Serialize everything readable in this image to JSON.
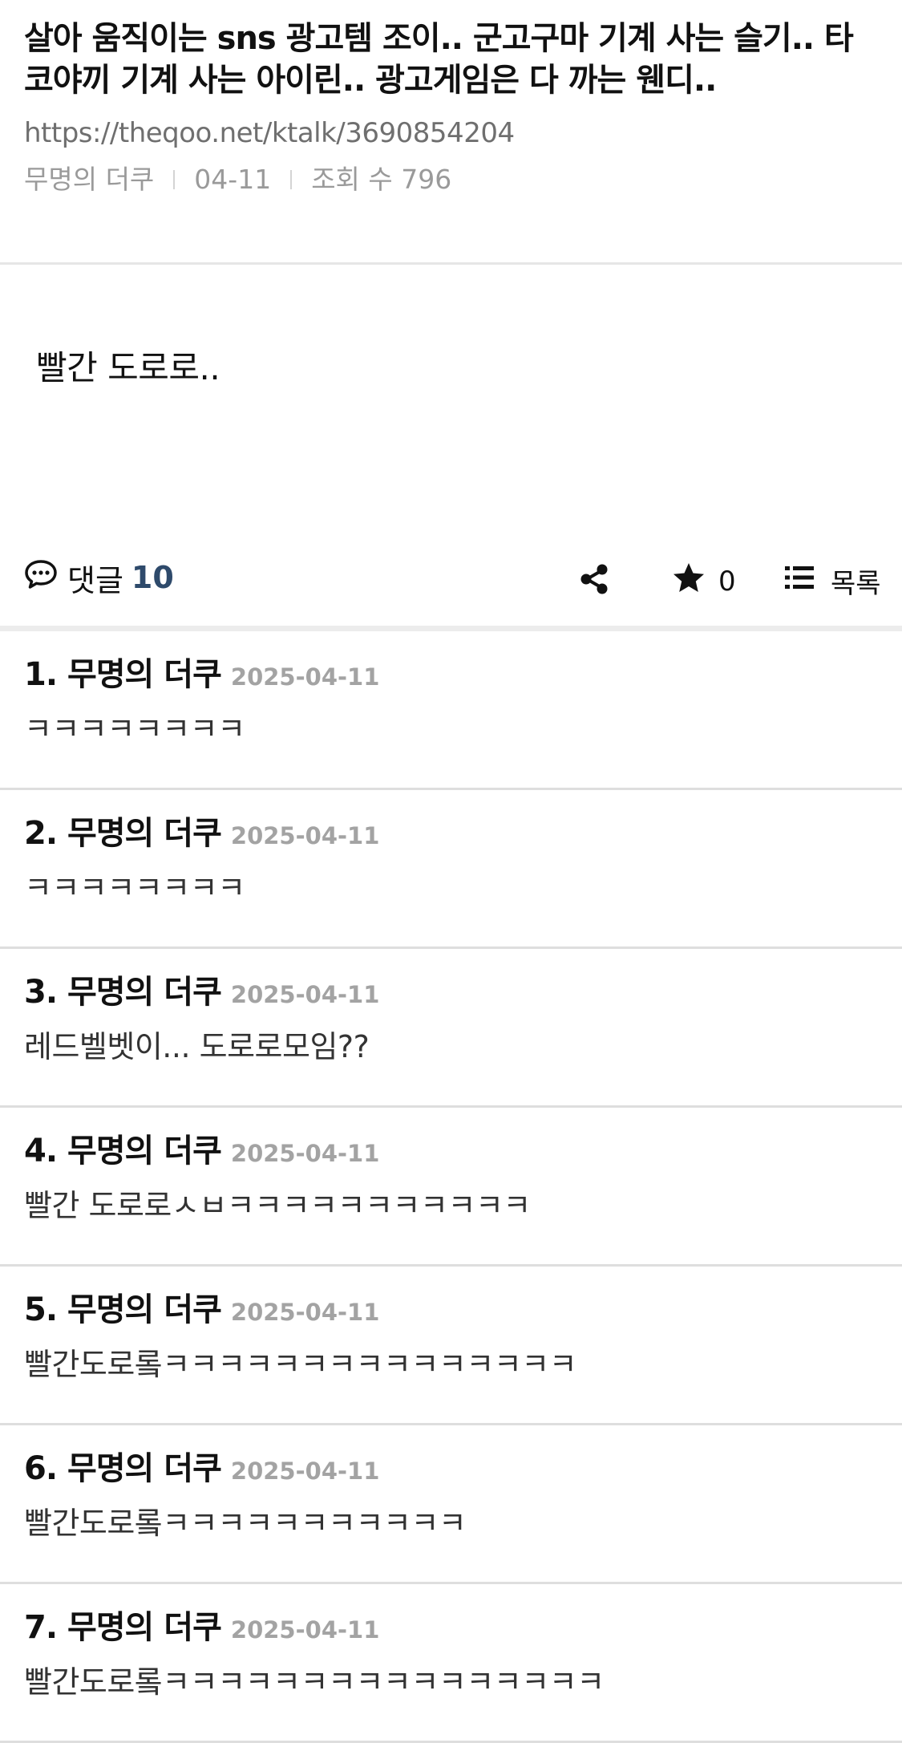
{
  "post": {
    "title": "살아 움직이는 sns 광고템 조이.. 군고구마 기계 사는 슬기.. 타코야끼 기계 사는 아이린.. 광고게임은 다 까는 웬디..",
    "url": "https://theqoo.net/ktalk/3690854204",
    "author": "무명의 더쿠",
    "date": "04-11",
    "views_label": "조회 수 796",
    "body": "빨간 도로로.."
  },
  "actions": {
    "comment_label": "댓글",
    "comment_count": "10",
    "share_icon": "share-icon",
    "star_icon": "star-icon",
    "star_count": "0",
    "list_icon": "list-icon",
    "list_label": "목록"
  },
  "comments": [
    {
      "author": "1. 무명의 더쿠",
      "date": "2025-04-11",
      "text": "ㅋㅋㅋㅋㅋㅋㅋㅋ"
    },
    {
      "author": "2. 무명의 더쿠",
      "date": "2025-04-11",
      "text": "ㅋㅋㅋㅋㅋㅋㅋㅋ"
    },
    {
      "author": "3. 무명의 더쿠",
      "date": "2025-04-11",
      "text": "레드벨벳이... 도로로모임??"
    },
    {
      "author": "4. 무명의 더쿠",
      "date": "2025-04-11",
      "text": "빨간 도로로ㅅㅂㅋㅋㅋㅋㅋㅋㅋㅋㅋㅋㅋ"
    },
    {
      "author": "5. 무명의 더쿠",
      "date": "2025-04-11",
      "text": "빨간도로롴ㅋㅋㅋㅋㅋㅋㅋㅋㅋㅋㅋㅋㅋㅋㅋ"
    },
    {
      "author": "6. 무명의 더쿠",
      "date": "2025-04-11",
      "text": "빨간도로롴ㅋㅋㅋㅋㅋㅋㅋㅋㅋㅋㅋ"
    },
    {
      "author": "7. 무명의 더쿠",
      "date": "2025-04-11",
      "text": "빨간도로롴ㅋㅋㅋㅋㅋㅋㅋㅋㅋㅋㅋㅋㅋㅋㅋㅋ"
    }
  ]
}
